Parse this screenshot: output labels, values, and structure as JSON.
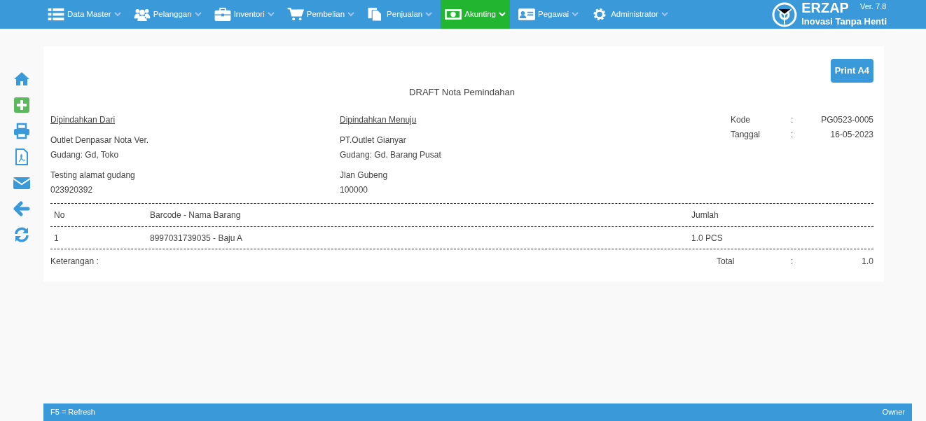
{
  "menu": [
    {
      "label": "Data Master",
      "selected": false
    },
    {
      "label": "Pelanggan",
      "selected": false
    },
    {
      "label": "Inventori",
      "selected": false
    },
    {
      "label": "Pembelian",
      "selected": false
    },
    {
      "label": "Penjualan",
      "selected": false
    },
    {
      "label": "Akunting",
      "selected": true
    },
    {
      "label": "Pegawai",
      "selected": false
    },
    {
      "label": "Administrator",
      "selected": false
    }
  ],
  "brand": {
    "name": "ERZAP",
    "version": "Ver. 7.8",
    "tagline": "Inovasi Tanpa Henti"
  },
  "print_button": "Print A4",
  "title": "DRAFT Nota Pemindahan",
  "from": {
    "heading": "Dipindahkan Dari",
    "name": "Outlet Denpasar Nota Ver.",
    "warehouse": "Gudang: Gd, Toko",
    "address": "Testing alamat gudang",
    "phone": "023920392"
  },
  "to": {
    "heading": "Dipindahkan Menuju",
    "name": "PT.Outlet Gianyar",
    "warehouse": "Gudang: Gd. Barang Pusat",
    "address": "Jlan Gubeng",
    "phone": "100000"
  },
  "info": [
    {
      "label": "Kode",
      "sep": ":",
      "value": "PG0523-0005"
    },
    {
      "label": "Tanggal",
      "sep": ":",
      "value": "16-05-2023"
    }
  ],
  "table": {
    "columns": [
      "No",
      "Barcode - Nama Barang",
      "Jumlah"
    ],
    "rows": [
      [
        "1",
        "8997031739035 - Baju A",
        "1.0 PCS"
      ]
    ]
  },
  "note_label": "Keterangan :",
  "total": {
    "label": "Total",
    "sep": ":",
    "value": "1.0"
  },
  "status_bar": {
    "left": "F5 = Refresh",
    "right": "Owner"
  }
}
